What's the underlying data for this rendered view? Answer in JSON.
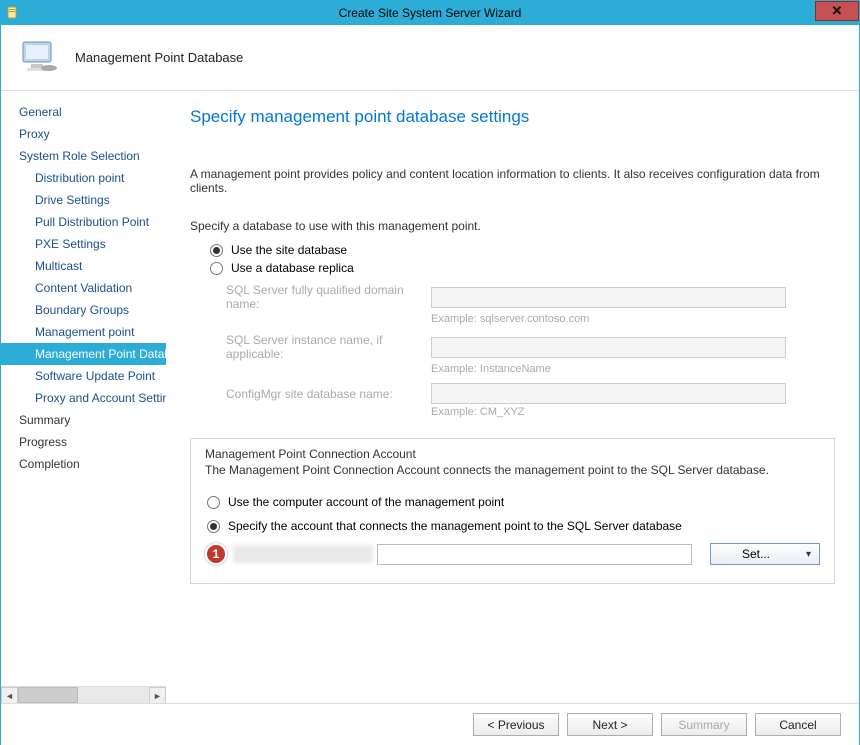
{
  "window": {
    "title": "Create Site System Server Wizard"
  },
  "header": {
    "title": "Management Point Database"
  },
  "sidebar": {
    "items": [
      {
        "label": "General",
        "sub": false
      },
      {
        "label": "Proxy",
        "sub": false
      },
      {
        "label": "System Role Selection",
        "sub": false
      },
      {
        "label": "Distribution point",
        "sub": true
      },
      {
        "label": "Drive Settings",
        "sub": true
      },
      {
        "label": "Pull Distribution Point",
        "sub": true
      },
      {
        "label": "PXE Settings",
        "sub": true
      },
      {
        "label": "Multicast",
        "sub": true
      },
      {
        "label": "Content Validation",
        "sub": true
      },
      {
        "label": "Boundary Groups",
        "sub": true
      },
      {
        "label": "Management point",
        "sub": true
      },
      {
        "label": "Management Point Database",
        "sub": true,
        "selected": true
      },
      {
        "label": "Software Update Point",
        "sub": true
      },
      {
        "label": "Proxy and Account Settings",
        "sub": true
      },
      {
        "label": "Summary",
        "sub": false
      },
      {
        "label": "Progress",
        "sub": false
      },
      {
        "label": "Completion",
        "sub": false
      }
    ]
  },
  "main": {
    "pageTitle": "Specify management point database settings",
    "description": "A management point provides policy and content location information to clients.  It also receives configuration data from clients.",
    "dbPrompt": "Specify a database to use with this management point.",
    "radioSiteDb": "Use the site database",
    "radioReplica": "Use a database replica",
    "fields": {
      "fqdnLabel": "SQL Server fully qualified domain name:",
      "fqdnExample": "Example: sqlserver.contoso.com",
      "instanceLabel": "SQL Server instance name, if applicable:",
      "instanceExample": "Example: InstanceName",
      "siteDbLabel": "ConfigMgr site database name:",
      "siteDbExample": "Example: CM_XYZ"
    },
    "connAccount": {
      "legend": "Management Point Connection Account",
      "desc": "The Management Point Connection Account connects the management point to the SQL Server database.",
      "radioComputer": "Use the computer account of the management point",
      "radioSpecify": "Specify the account that connects the management point to the SQL Server database",
      "setLabel": "Set...",
      "annotation": "1"
    }
  },
  "footer": {
    "previous": "< Previous",
    "next": "Next >",
    "summary": "Summary",
    "cancel": "Cancel"
  }
}
